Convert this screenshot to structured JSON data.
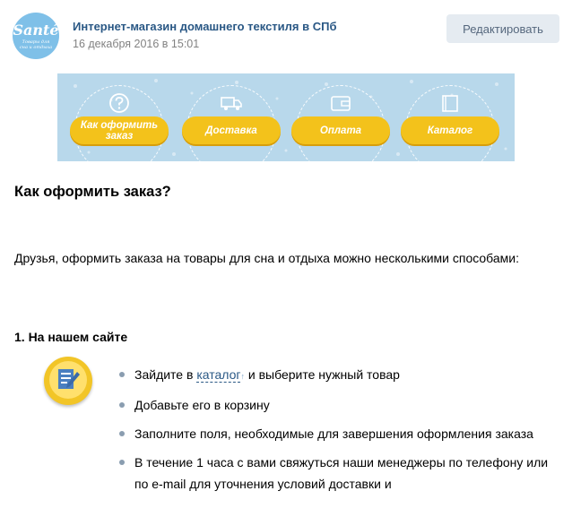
{
  "header": {
    "avatar": {
      "brand": "Santé",
      "tagline": "Товары для сна и отдыха"
    },
    "title": "Интернет-магазин домашнего текстиля в СПб",
    "date": "16 декабря 2016 в 15:01",
    "edit_label": "Редактировать"
  },
  "banner": {
    "items": [
      {
        "label": "Как оформить заказ",
        "icon": "question-icon"
      },
      {
        "label": "Доставка",
        "icon": "truck-icon"
      },
      {
        "label": "Оплата",
        "icon": "wallet-icon"
      },
      {
        "label": "Каталог",
        "icon": "catalog-icon"
      }
    ]
  },
  "article": {
    "heading": "Как оформить заказ?",
    "intro": "Друзья, оформить заказа на товары для сна и отдыха можно несколькими способами:",
    "section1": {
      "heading": "1. На нашем сайте",
      "icon": "edit-note-icon",
      "steps": [
        {
          "before": "Зайдите в ",
          "link": "каталог",
          "after": " и выберите нужный товар"
        },
        {
          "text": "Добавьте его в корзину"
        },
        {
          "text": "Заполните поля, необходимые для завершения оформления заказа"
        },
        {
          "text": "В течение 1 часа с вами свяжуться наши менеджеры по телефону или по e-mail для уточнения условий доставки и"
        }
      ]
    }
  },
  "colors": {
    "link": "#2a5885",
    "banner_bg": "#b8d8eb",
    "pill": "#f3c21b",
    "button_bg": "#e5ebf1"
  }
}
